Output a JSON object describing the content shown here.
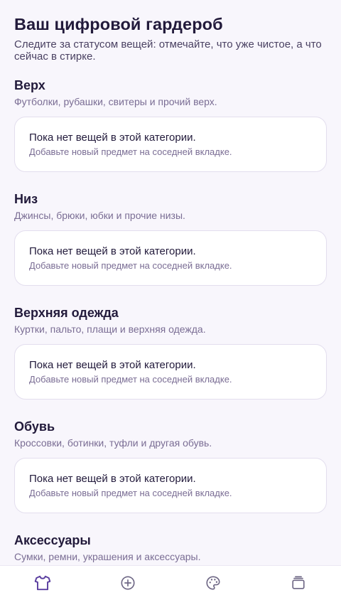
{
  "header": {
    "title": "Ваш цифровой гардероб",
    "subtitle": "Следите за статусом вещей: отмечайте, что уже чистое, а что сейчас в стирке."
  },
  "empty_state": {
    "title": "Пока нет вещей в этой категории.",
    "hint": "Добавьте новый предмет на соседней вкладке."
  },
  "categories": [
    {
      "title": "Верх",
      "description": "Футболки, рубашки, свитеры и прочий верх."
    },
    {
      "title": "Низ",
      "description": "Джинсы, брюки, юбки и прочие низы."
    },
    {
      "title": "Верхняя одежда",
      "description": "Куртки, пальто, плащи и верхняя одежда."
    },
    {
      "title": "Обувь",
      "description": "Кроссовки, ботинки, туфли и другая обувь."
    },
    {
      "title": "Аксессуары",
      "description": "Сумки, ремни, украшения и аксессуары."
    }
  ],
  "tabbar": {
    "tabs": [
      {
        "icon": "shirt-icon",
        "active": true
      },
      {
        "icon": "plus-circle-icon",
        "active": false
      },
      {
        "icon": "palette-icon",
        "active": false
      },
      {
        "icon": "layers-icon",
        "active": false
      }
    ],
    "active_color": "#5b3fa0",
    "inactive_color": "#6e6785"
  }
}
